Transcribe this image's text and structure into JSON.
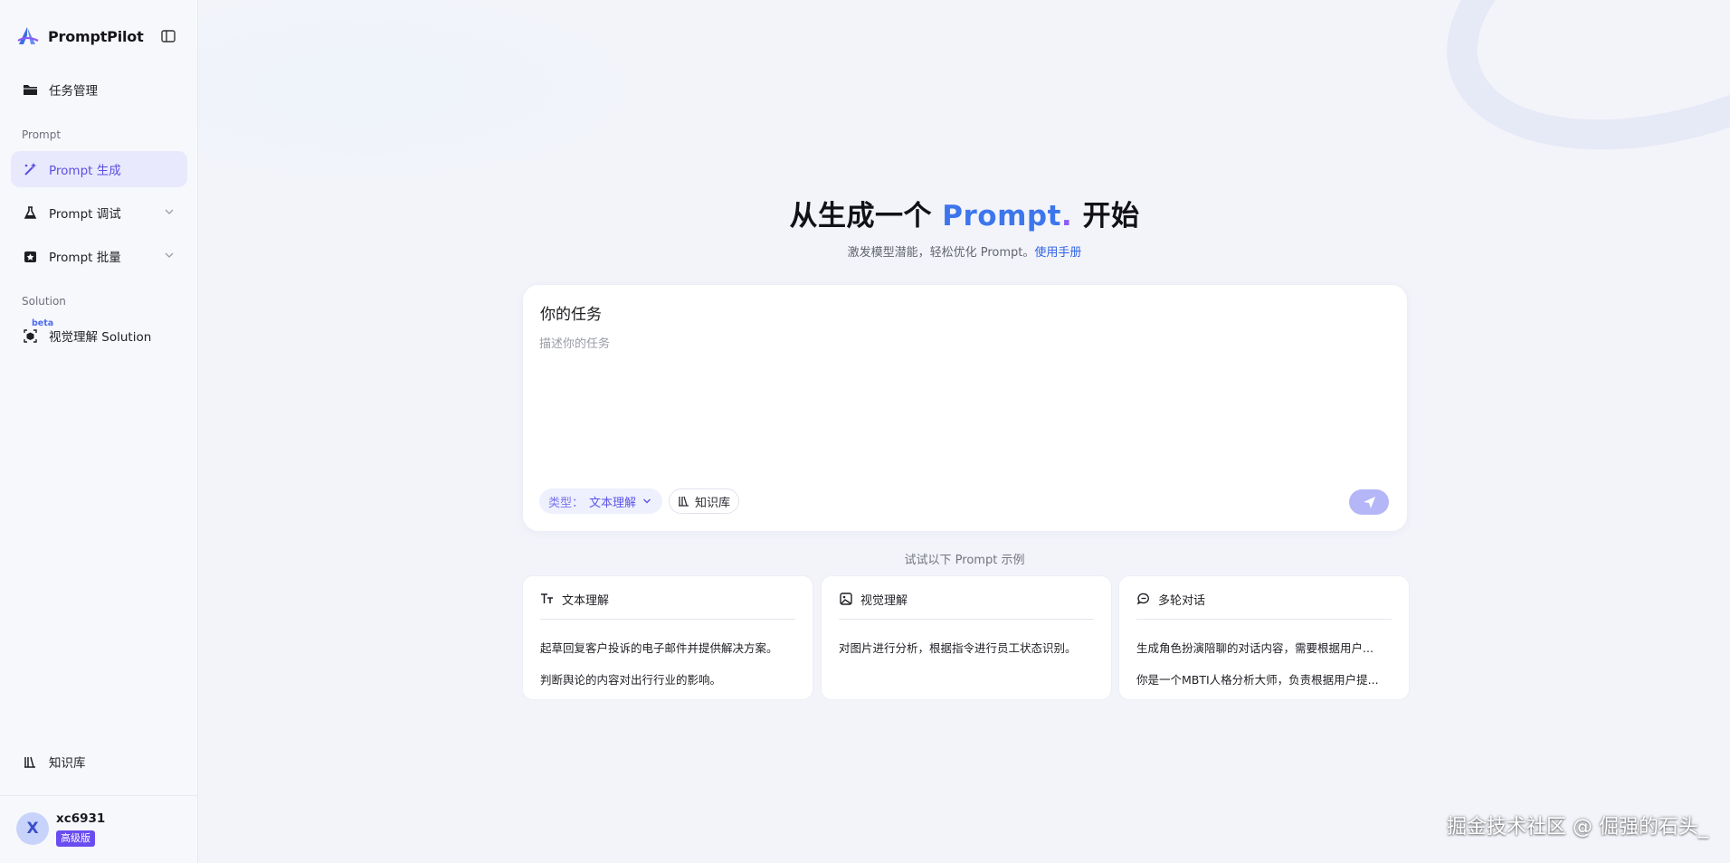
{
  "app": {
    "name": "PromptPilot"
  },
  "sidebar": {
    "task_mgmt": "任务管理",
    "section_prompt": "Prompt",
    "prompt_generate": "Prompt 生成",
    "prompt_debug": "Prompt 调试",
    "prompt_batch": "Prompt 批量",
    "section_solution": "Solution",
    "beta_badge": "beta",
    "vision_solution": "视觉理解 Solution",
    "knowledge_base": "知识库"
  },
  "user": {
    "avatar_letter": "X",
    "name": "xc6931",
    "plan": "高级版"
  },
  "hero": {
    "title_pre": "从生成一个 ",
    "title_accent": "Prompt",
    "title_dot": ".",
    "title_post": " 开始",
    "subtitle": "激发模型潜能，轻松优化 Prompt。",
    "manual_link": "使用手册"
  },
  "task": {
    "title": "你的任务",
    "placeholder": "描述你的任务",
    "type_prefix": "类型：",
    "type_value": "文本理解",
    "kb_button": "知识库"
  },
  "examples": {
    "label": "试试以下 Prompt 示例",
    "cards": [
      {
        "title": "文本理解",
        "icon": "text-type-icon",
        "lines": [
          "起草回复客户投诉的电子邮件并提供解决方案。",
          "判断舆论的内容对出行行业的影响。"
        ]
      },
      {
        "title": "视觉理解",
        "icon": "image-icon",
        "lines": [
          "对图片进行分析，根据指令进行员工状态识别。"
        ]
      },
      {
        "title": "多轮对话",
        "icon": "chat-bubble-icon",
        "lines": [
          "生成角色扮演陪聊的对话内容，需要根据用户...",
          "你是一个MBTI人格分析大师，负责根据用户提..."
        ]
      }
    ]
  },
  "watermark": "掘金技术社区 @ 倔强的石头_",
  "colors": {
    "accent": "#5b4fe3",
    "link": "#2f63e6",
    "plan_badge": "#6a4df0",
    "send": "#b4b6f8"
  }
}
